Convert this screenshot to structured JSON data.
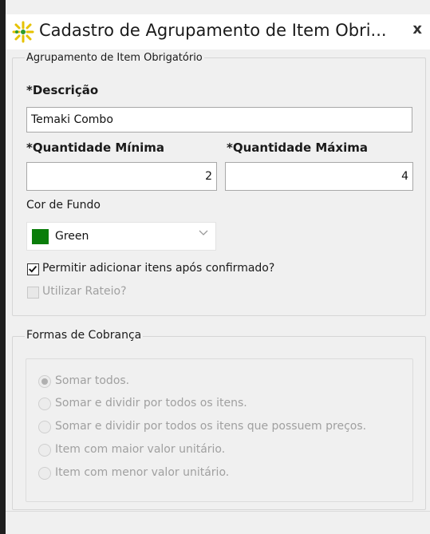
{
  "window": {
    "title": "Cadastro de Agrupamento de Item Obri...",
    "close_label": "x"
  },
  "group_main": {
    "legend": "Agrupamento de Item Obrigatório",
    "descricao_label": "*Descrição",
    "descricao_value": "Temaki Combo",
    "qtd_min_label": "*Quantidade Mínima",
    "qtd_min_value": "2",
    "qtd_max_label": "*Quantidade Máxima",
    "qtd_max_value": "4",
    "cor_label": "Cor de Fundo",
    "cor_value": "Green",
    "cor_color": "#0a7d0a",
    "permitir_label": "Permitir adicionar itens após confirmado?",
    "permitir_checked": true,
    "rateio_label": "Utilizar Rateio?",
    "rateio_checked": false
  },
  "group_cobranca": {
    "legend": "Formas de Cobrança",
    "options": [
      {
        "label": "Somar todos.",
        "selected": true
      },
      {
        "label": "Somar e dividir por todos os itens.",
        "selected": false
      },
      {
        "label": "Somar e dividir por todos os itens que possuem preços.",
        "selected": false
      },
      {
        "label": "Item com maior valor unitário.",
        "selected": false
      },
      {
        "label": "Item com menor valor unitário.",
        "selected": false
      }
    ]
  },
  "icons": {
    "app": "sparkle-app-icon",
    "close": "close-icon",
    "dropdown": "chevron-down-icon",
    "check": "checkmark-icon"
  }
}
